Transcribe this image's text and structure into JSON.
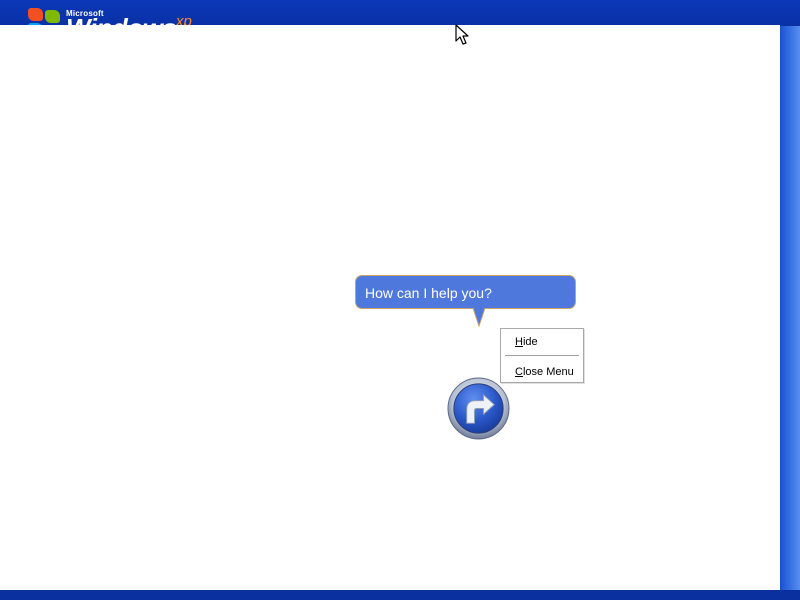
{
  "desktop": {
    "logo": {
      "brand": "Microsoft",
      "product": "Windows",
      "edition": "xp"
    }
  },
  "assistant": {
    "balloon_text": "How can I help you?",
    "button_icon": "right-turn-arrow-icon"
  },
  "context_menu": {
    "items": [
      {
        "label": "Hide",
        "mnemonic": "H"
      },
      {
        "label": "Close Menu",
        "mnemonic": "C"
      }
    ]
  },
  "colors": {
    "desktop_blue": "#0a2fa0",
    "balloon_fill": "#4f78dc",
    "balloon_border": "#c9a36a",
    "panel": "#ffffff"
  }
}
